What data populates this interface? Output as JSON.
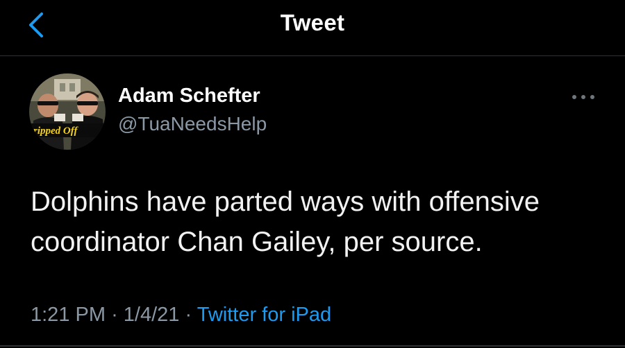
{
  "header": {
    "title": "Tweet",
    "back_icon": "chevron-left-icon",
    "accent_color": "#1d9bf0"
  },
  "author": {
    "display_name": "Adam Schefter",
    "handle": "@TuaNeedsHelp",
    "more_icon": "more-horizontal-icon",
    "avatar_caption": "ripped Off"
  },
  "tweet": {
    "text": "Dolphins have parted ways with offensive coordinator Chan Gailey, per source.",
    "time": "1:21 PM",
    "separator": "·",
    "date": "1/4/21",
    "source": "Twitter for iPad"
  }
}
